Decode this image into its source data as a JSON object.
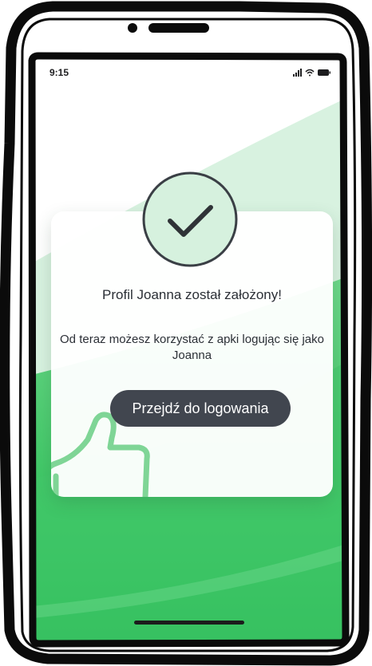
{
  "status_bar": {
    "time": "9:15",
    "icons": [
      "signal-icon",
      "wifi-icon",
      "battery-icon"
    ]
  },
  "dialog": {
    "icon": "checkmark-icon",
    "title": "Profil Joanna został założony!",
    "message": "Od teraz możesz korzystać z apki logując się jako Joanna",
    "button_label": "Przejdź do logowania",
    "decoration_icon": "thumbs-up-icon"
  },
  "colors": {
    "accent_green": "#2dbf5a",
    "light_green": "#d6f1de",
    "button_dark": "#41464f",
    "text_dark": "#2b2f36"
  }
}
